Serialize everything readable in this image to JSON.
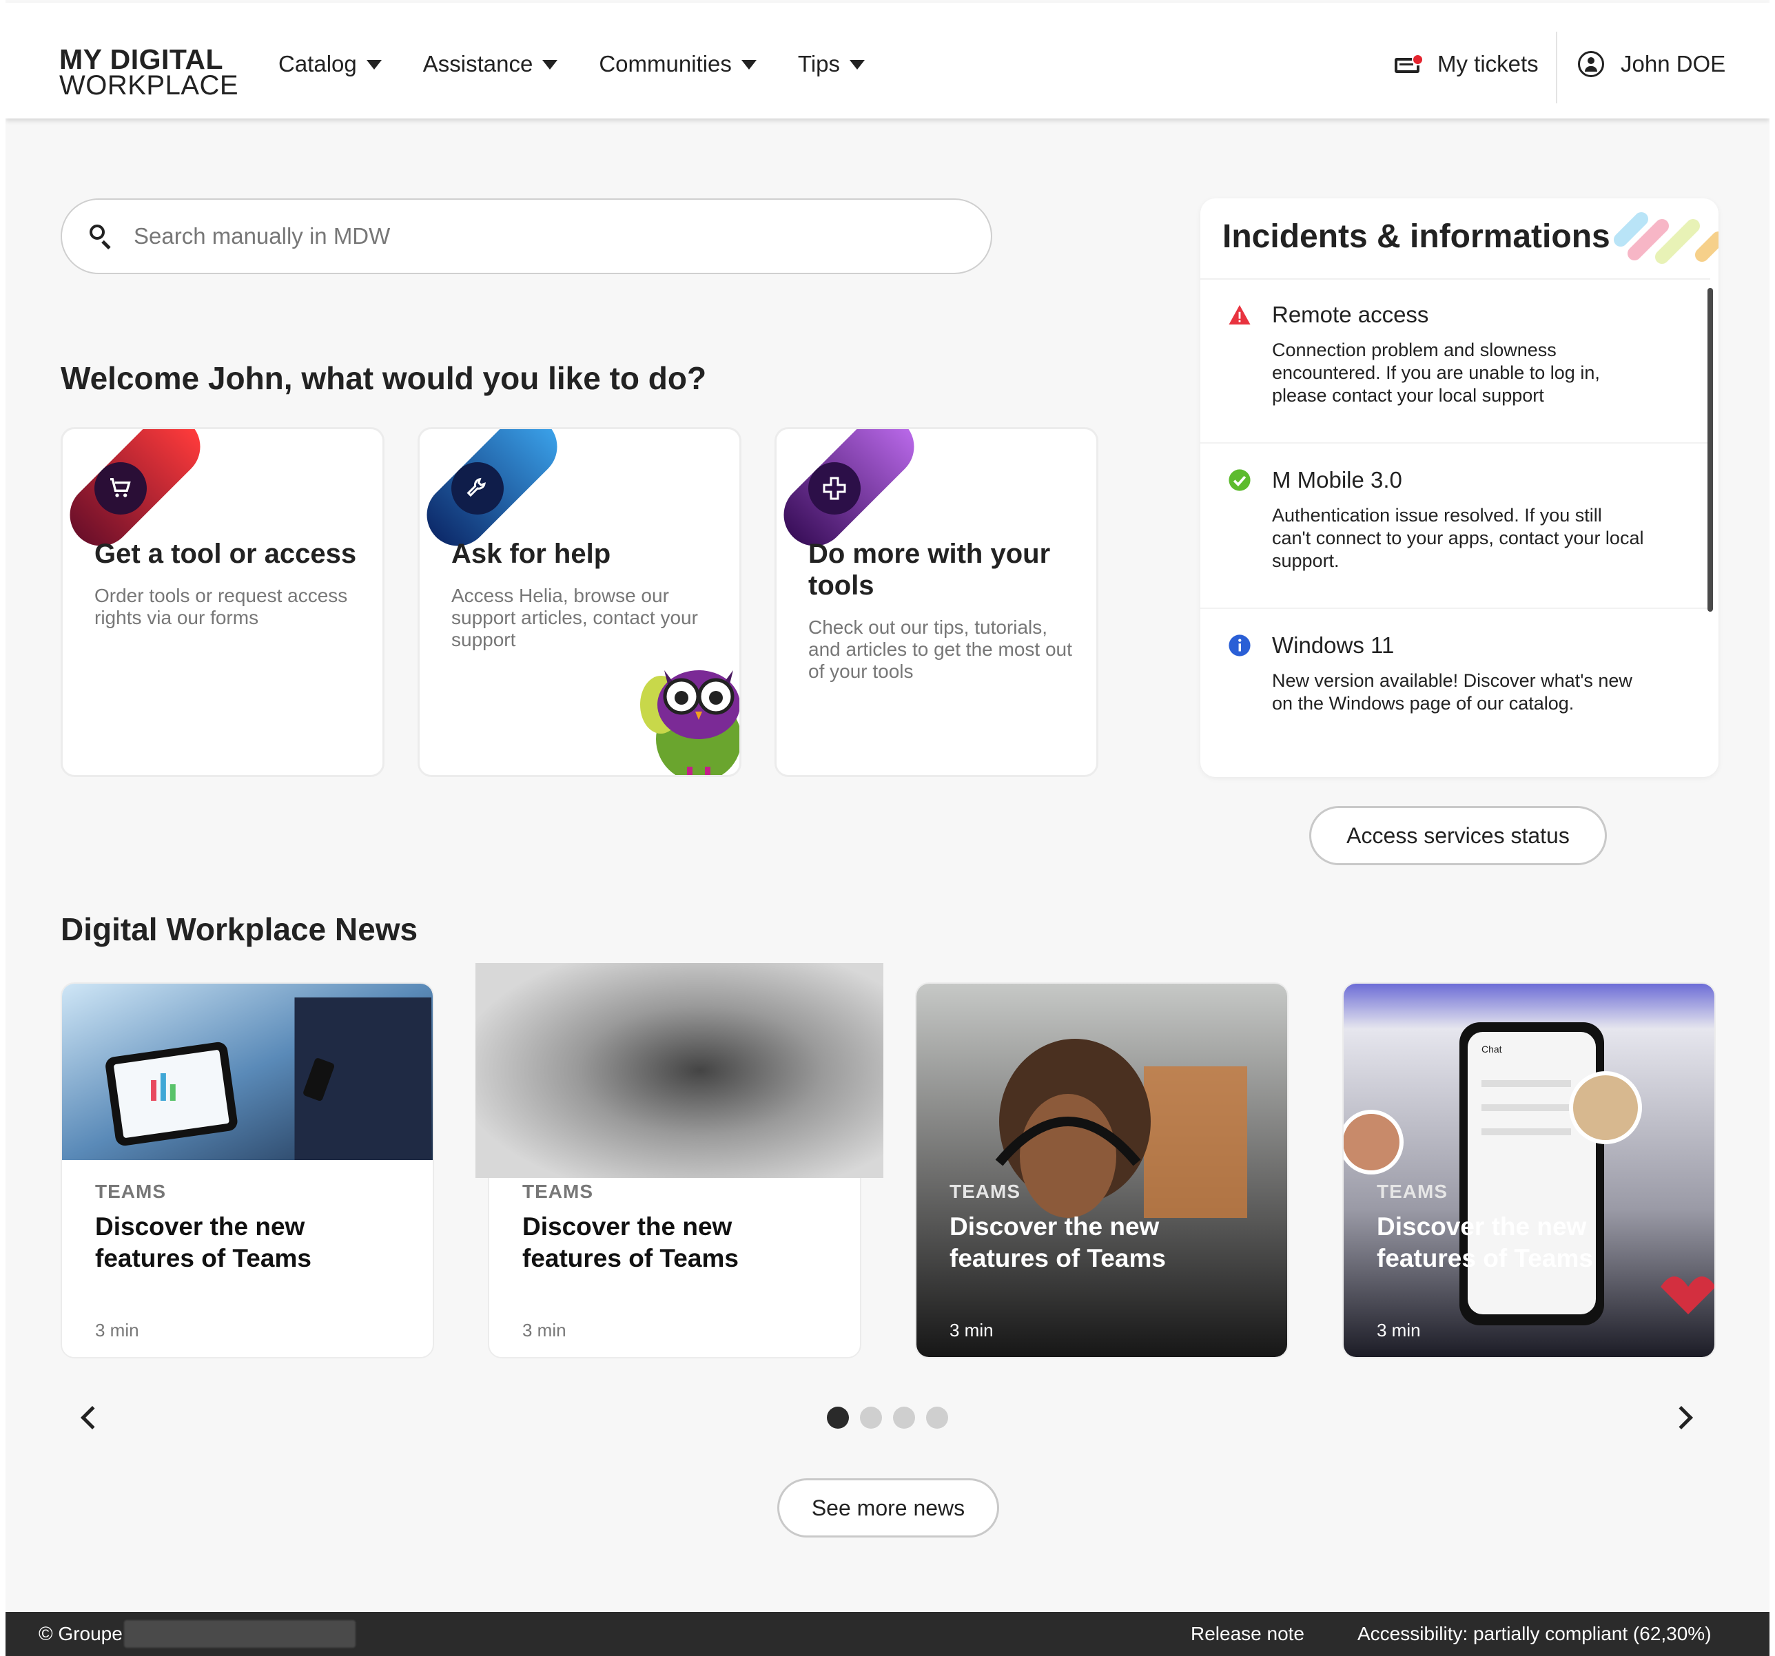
{
  "brand": {
    "line1": "MY DIGITAL",
    "line2": "WORKPLACE"
  },
  "nav": [
    {
      "label": "Catalog"
    },
    {
      "label": "Assistance"
    },
    {
      "label": "Communities"
    },
    {
      "label": "Tips"
    }
  ],
  "header": {
    "tickets_label": "My tickets",
    "user_name": "John DOE"
  },
  "search": {
    "placeholder": "Search manually in MDW",
    "value": ""
  },
  "welcome": "Welcome John, what would you like to do?",
  "actions": [
    {
      "title": "Get a tool or access",
      "description": "Order tools or request access rights via our forms",
      "icon": "cart-icon",
      "color": "#c8102e"
    },
    {
      "title": "Ask for help",
      "description": "Access Helia, browse our support articles, contact your support",
      "icon": "wrench-icon",
      "color": "#1d5fa8"
    },
    {
      "title": "Do more with your tools",
      "description": "Check out our tips, tutorials, and articles to get the most out of your tools",
      "icon": "plus-icon",
      "color": "#6a2a9c"
    }
  ],
  "incidents": {
    "title": "Incidents & informations",
    "items": [
      {
        "title": "Remote access",
        "description": "Connection problem and slowness encountered. If you are unable to log in, please contact your local support",
        "status": "warning",
        "icon": "warning-icon",
        "color": "#e8333f"
      },
      {
        "title": "M Mobile 3.0",
        "description": "Authentication issue resolved. If you still can't connect to your apps, contact your local support.",
        "status": "resolved",
        "icon": "check-icon",
        "color": "#5dbb2e"
      },
      {
        "title": "Windows 11",
        "description": "New version available! Discover what's new on the Windows page of our catalog.",
        "status": "info",
        "icon": "info-icon",
        "color": "#2a5fd6"
      }
    ],
    "status_button": "Access services status"
  },
  "news": {
    "title": "Digital Workplace News",
    "items": [
      {
        "category": "TEAMS",
        "title": "Discover the new features of Teams",
        "duration": "3 min"
      },
      {
        "category": "TEAMS",
        "title": "Discover the new features of Teams",
        "duration": "3 min"
      },
      {
        "category": "TEAMS",
        "title": "Discover the new features of Teams",
        "duration": "3 min"
      },
      {
        "category": "TEAMS",
        "title": "Discover the new features of Teams",
        "duration": "3 min"
      }
    ],
    "pagination": {
      "current": 1,
      "total": 4
    },
    "more_button": "See more news"
  },
  "footer": {
    "copyright": "© Groupe",
    "release_note": "Release note",
    "accessibility": "Accessibility: partially compliant (62,30%)"
  }
}
